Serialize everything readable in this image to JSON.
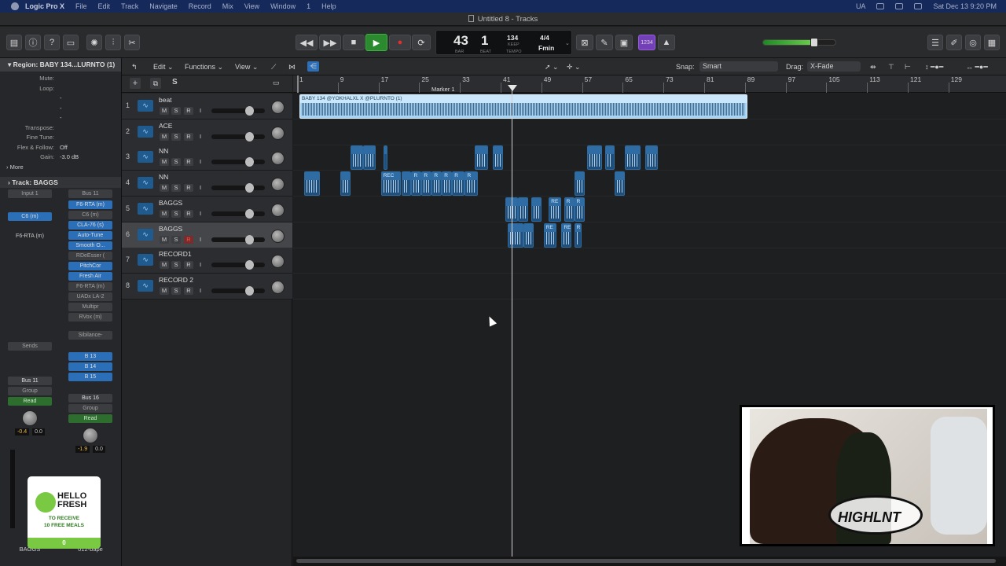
{
  "menubar": {
    "app": "Logic Pro X",
    "items": [
      "File",
      "Edit",
      "Track",
      "Navigate",
      "Record",
      "Mix",
      "View",
      "Window",
      "1",
      "Help"
    ],
    "lang": "UA",
    "clock": "Sat Dec 13  9:20 PM"
  },
  "window": {
    "title": "Untitled 8 - Tracks"
  },
  "lcd": {
    "bar": "43",
    "beat": "1",
    "bar_label": "BAR",
    "beat_label": "BEAT",
    "tempo": "134",
    "keep": "KEEP",
    "tempo_label": "TEMPO",
    "sig": "4/4",
    "key": "Fmin"
  },
  "count_in": "1234",
  "inspector": {
    "region_title": "Region: BABY 134...LURNTO (1)",
    "params": [
      {
        "k": "Mute:",
        "v": ""
      },
      {
        "k": "Loop:",
        "v": ""
      },
      {
        "k": "",
        "v": "-"
      },
      {
        "k": "",
        "v": "-"
      },
      {
        "k": "",
        "v": "-"
      },
      {
        "k": "Transpose:",
        "v": ""
      },
      {
        "k": "Fine Tune:",
        "v": ""
      },
      {
        "k": "Flex & Follow:",
        "v": "Off"
      },
      {
        "k": "Gain:",
        "v": "-3.0 dB"
      }
    ],
    "more": "More",
    "track_title": "Track:  BAGGS",
    "strip1": {
      "input": "Input 1",
      "plugins": [
        "C6 (m)",
        "F6-RTA (m)"
      ],
      "sends": [
        "Sends"
      ],
      "out": "Bus 11",
      "group": "Group",
      "auto": "Read",
      "pan": "-0.4",
      "db": "0.0",
      "name": "BAGGS"
    },
    "strip2": {
      "input": "Bus 11",
      "plugins": [
        "F6-RTA (m)",
        "C6 (m)",
        "CLA-76 (s)",
        "Auto-Tune",
        "Smooth O...",
        "RDeEsser (",
        "PitchCor",
        "Fresh Air",
        "F6-RTA (m)",
        "UADx LA-2",
        "Multipr",
        "RVox (m)"
      ],
      "extra": "Sibilance-",
      "sends": [
        "B 13",
        "B 14",
        "B 15"
      ],
      "out": "Bus 16",
      "group": "Group",
      "auto": "Read",
      "pan": "-1.9",
      "db": "0.0",
      "name": "012-bape"
    }
  },
  "hellofresh": {
    "brand1": "HELLO",
    "brand2": "FRESH",
    "line1": "TO RECEIVE",
    "line2": "10 FREE MEALS",
    "count": "0"
  },
  "tracks_header": {
    "edit": "Edit",
    "functions": "Functions",
    "view": "View",
    "snap_label": "Snap:",
    "snap": "Smart",
    "drag_label": "Drag:",
    "drag": "X-Fade"
  },
  "tracks": [
    {
      "num": "1",
      "name": "beat",
      "vol": 0.72,
      "sel": false
    },
    {
      "num": "2",
      "name": "ACE",
      "vol": 0.72,
      "sel": false
    },
    {
      "num": "3",
      "name": "NN",
      "vol": 0.72,
      "sel": false
    },
    {
      "num": "4",
      "name": "NN",
      "vol": 0.72,
      "sel": false
    },
    {
      "num": "5",
      "name": "BAGGS",
      "vol": 0.72,
      "sel": false
    },
    {
      "num": "6",
      "name": "BAGGS",
      "vol": 0.72,
      "sel": true
    },
    {
      "num": "7",
      "name": "RECORD1",
      "vol": 0.72,
      "sel": false
    },
    {
      "num": "8",
      "name": "RECORD 2",
      "vol": 0.72,
      "sel": false
    }
  ],
  "ruler": {
    "marks": [
      "1",
      "9",
      "17",
      "25",
      "33",
      "41",
      "49",
      "57",
      "65",
      "73",
      "81",
      "89",
      "97",
      "105",
      "113",
      "121",
      "129"
    ],
    "marker": "Marker 1"
  },
  "region_main": "BABY 134 @YOKHALXL X @PLURNTO (1)",
  "region_tags": {
    "rec": "REC",
    "re": "RE",
    "r": "R"
  },
  "webcam": {
    "logo": "HIGHLNT"
  }
}
